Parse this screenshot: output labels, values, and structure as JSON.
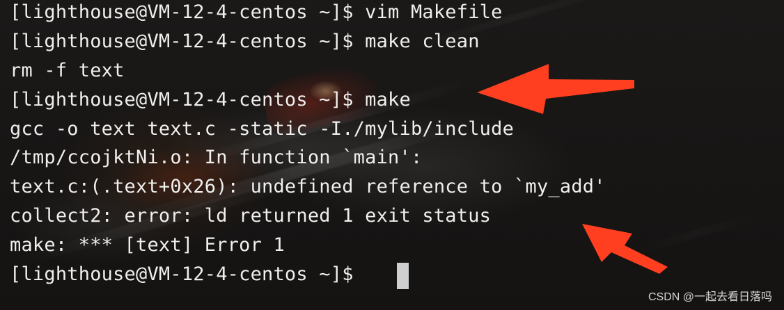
{
  "terminal": {
    "lines": [
      "[lighthouse@VM-12-4-centos ~]$ vim Makefile",
      "[lighthouse@VM-12-4-centos ~]$ make clean",
      "rm -f text",
      "[lighthouse@VM-12-4-centos ~]$ make",
      "gcc -o text text.c -static -I./mylib/include",
      "/tmp/ccojktNi.o: In function `main':",
      "text.c:(.text+0x26): undefined reference to `my_add'",
      "collect2: error: ld returned 1 exit status",
      "make: *** [text] Error 1",
      "[lighthouse@VM-12-4-centos ~]$ "
    ]
  },
  "annotations": {
    "arrow_color": "#ff3f1f",
    "arrow_icon_1": "arrow-icon",
    "arrow_icon_2": "arrow-icon"
  },
  "watermark": {
    "text": "CSDN @一起去看日落吗"
  },
  "colors": {
    "text": "#f1efee",
    "cursor": "#cfcfcf",
    "watermark": "rgba(255,255,255,0.82)"
  }
}
